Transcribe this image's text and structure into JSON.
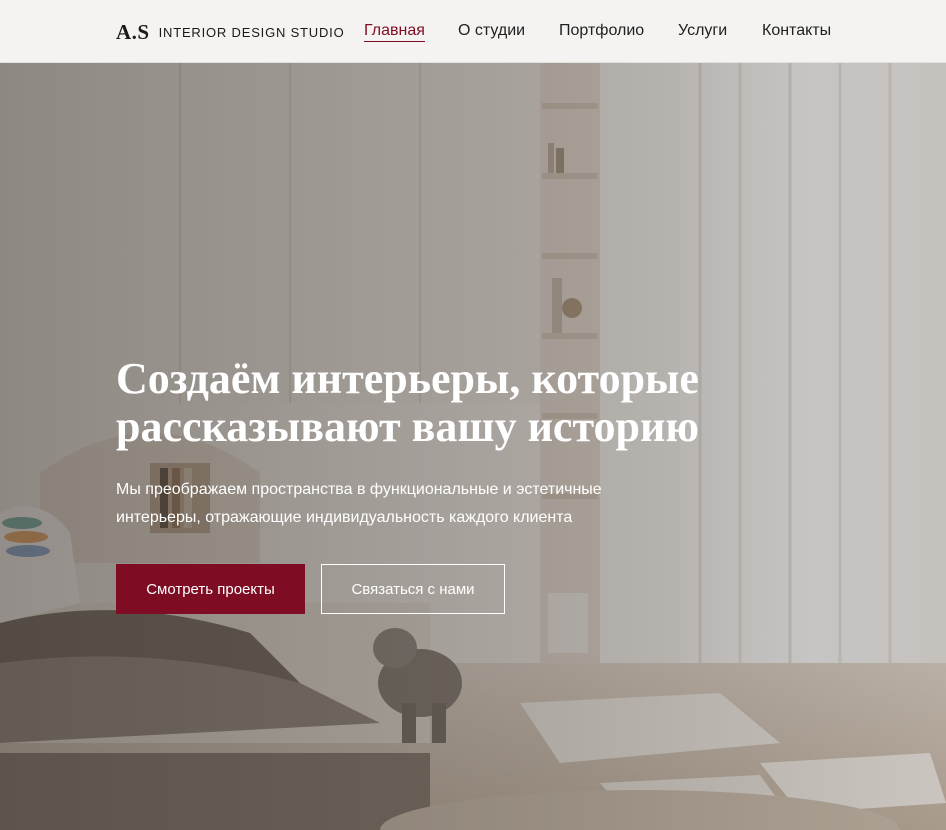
{
  "header": {
    "logo_mark": "A.S",
    "logo_text": "INTERIOR DESIGN STUDIO",
    "nav": [
      {
        "label": "Главная",
        "active": true
      },
      {
        "label": "О студии",
        "active": false
      },
      {
        "label": "Портфолио",
        "active": false
      },
      {
        "label": "Услуги",
        "active": false
      },
      {
        "label": "Контакты",
        "active": false
      }
    ]
  },
  "hero": {
    "title_line1": "Создаём интерьеры, которые",
    "title_line2": "рассказывают вашу историю",
    "subtitle_line1": "Мы преображаем пространства в функциональные и эстетичные",
    "subtitle_line2": "интерьеры, отражающие индивидуальность каждого клиента",
    "primary_button": "Смотреть проекты",
    "secondary_button": "Связаться с нами",
    "background_image": "bright children's bedroom with bed, shelves and curtains"
  },
  "colors": {
    "accent": "#7e0c22",
    "header_bg": "#f4f3f2",
    "text_dark": "#1f1f1f",
    "hero_text": "#ffffff"
  }
}
